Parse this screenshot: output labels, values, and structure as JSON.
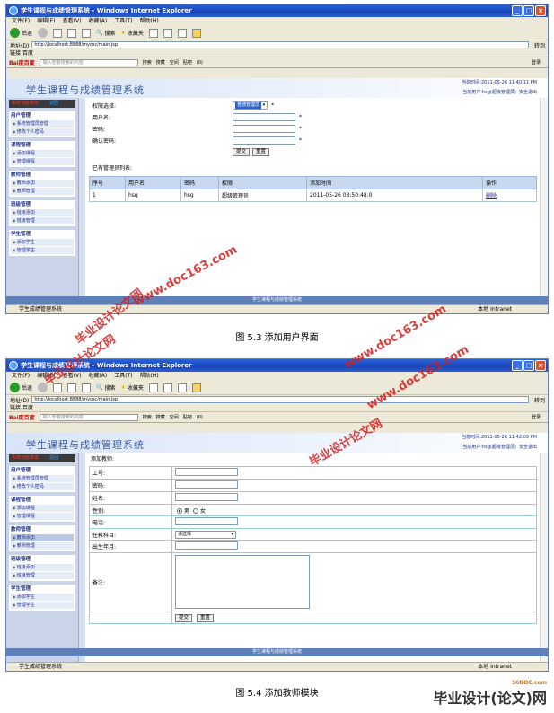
{
  "browser": {
    "window_title": "学生课程与成绩管理系统 - Windows Internet Explorer",
    "menu": [
      "文件(F)",
      "编辑(E)",
      "查看(V)",
      "收藏(A)",
      "工具(T)",
      "帮助(H)"
    ],
    "toolbar": {
      "back": "后退",
      "search": "搜索",
      "favorites": "收藏夹"
    },
    "address_label": "地址(D)",
    "address_url": "http://localhost:8888/mycsc/main.jsp",
    "go": "转到",
    "links_label": "链接",
    "links_item": "百度",
    "baidu_logo": "Bai度百度",
    "baidu_placeholder": "输入想要搜索的内容",
    "baidu_search": "搜索",
    "baidu_items": [
      "搜藏",
      "空间",
      "贴吧",
      "(0)"
    ],
    "baidu_login": "登录",
    "status_text": "学生成绩管理系统",
    "status_zone": "本地 Intranet",
    "status_zone_2": "本地 Intranet"
  },
  "app": {
    "title": "学生课程与成绩管理系统",
    "time_label": "当前时间:2011-05-26 11:40:11 PM",
    "time_label_2": "当前时间:2011-05-26 11:42:09 PM",
    "current_user": "当前用户:hsg(超级管理员)",
    "logout": "安全退出",
    "sidebar_head": "系统功能菜单",
    "sidebar_return": "返回",
    "sections": [
      {
        "title": "用户管理",
        "items": [
          "系统管理员管理",
          "修改个人密码"
        ]
      },
      {
        "title": "课程管理",
        "items": [
          "添加课程",
          "管理课程"
        ]
      },
      {
        "title": "教师管理",
        "items": [
          "教师添加",
          "教师管理"
        ]
      },
      {
        "title": "班级管理",
        "items": [
          "班级添加",
          "班级管理"
        ]
      },
      {
        "title": "学生管理",
        "items": [
          "添加学生",
          "管理学生"
        ]
      }
    ],
    "footer": "学生课程与成绩管理系统"
  },
  "screen1": {
    "fields": [
      {
        "label": "权限选择:",
        "type": "select",
        "value": "普通管理员"
      },
      {
        "label": "用户名:",
        "type": "text"
      },
      {
        "label": "密码:",
        "type": "text"
      },
      {
        "label": "确认密码:",
        "type": "text"
      }
    ],
    "required": "*",
    "submit": "提交",
    "reset": "重置",
    "list_title": "已有管理员列表:",
    "columns": [
      "序号",
      "用户名",
      "密码",
      "权限",
      "添加时间",
      "操作"
    ],
    "rows": [
      {
        "no": "1",
        "username": "hsg",
        "password": "hsg",
        "role": "超级管理员",
        "time": "2011-05-26 03:50:48.0",
        "op": "删除"
      }
    ],
    "caption": "图 5.3   添加用户界面"
  },
  "screen2": {
    "heading": "添加教师:",
    "fields": [
      "工号:",
      "密码:",
      "姓名:",
      "性别:",
      "电话:",
      "任教科目:",
      "出生年月:",
      "备注:"
    ],
    "gender_male": "男",
    "gender_female": "女",
    "subject_select": "请选择",
    "submit": "提交",
    "reset": "重置",
    "caption": "图 5.4   添加教师模块"
  },
  "watermarks": [
    "www.doc163.com",
    "毕业设计论文网",
    "毕业设计论文网",
    "www.doc163.com",
    "毕业设计论文网",
    "www.doc163.com"
  ],
  "brand": {
    "name": "毕业设计(论文)网",
    "url": "56DOC.com"
  }
}
